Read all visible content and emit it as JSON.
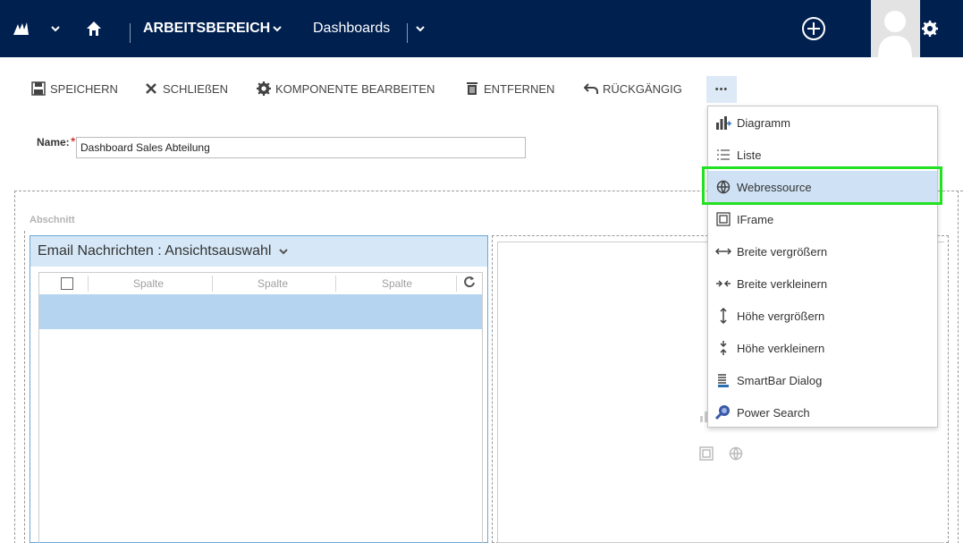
{
  "nav": {
    "workspace_label": "ARBEITSBEREICH",
    "area_label": "Dashboards"
  },
  "commands": {
    "save": "SPEICHERN",
    "close": "SCHLIEßEN",
    "edit_component": "KOMPONENTE BEARBEITEN",
    "remove": "ENTFERNEN",
    "undo": "RÜCKGÄNGIG",
    "more": "•••"
  },
  "form": {
    "name_label": "Name:",
    "required_marker": "*",
    "name_value": "Dashboard Sales Abteilung"
  },
  "section": {
    "label": "Abschnitt"
  },
  "component": {
    "title": "Email Nachrichten : Ansichtsauswahl",
    "columns": [
      "Spalte",
      "Spalte",
      "Spalte"
    ]
  },
  "menu": {
    "items": [
      {
        "label": "Diagramm",
        "icon": "chart-icon"
      },
      {
        "label": "Liste",
        "icon": "list-icon"
      },
      {
        "label": "Webressource",
        "icon": "globe-icon",
        "selected": true
      },
      {
        "label": "IFrame",
        "icon": "iframe-icon"
      },
      {
        "label": "Breite vergrößern",
        "icon": "widen-icon"
      },
      {
        "label": "Breite verkleinern",
        "icon": "narrow-icon"
      },
      {
        "label": "Höhe vergrößern",
        "icon": "taller-icon"
      },
      {
        "label": "Höhe verkleinern",
        "icon": "shorter-icon"
      },
      {
        "label": "SmartBar Dialog",
        "icon": "smartbar-icon"
      },
      {
        "label": "Power Search",
        "icon": "power-search-icon"
      }
    ]
  },
  "colors": {
    "navbar": "#002050",
    "selected_row": "#b4d4ef",
    "component_header": "#d6e8f7",
    "highlight": "#22e022"
  }
}
